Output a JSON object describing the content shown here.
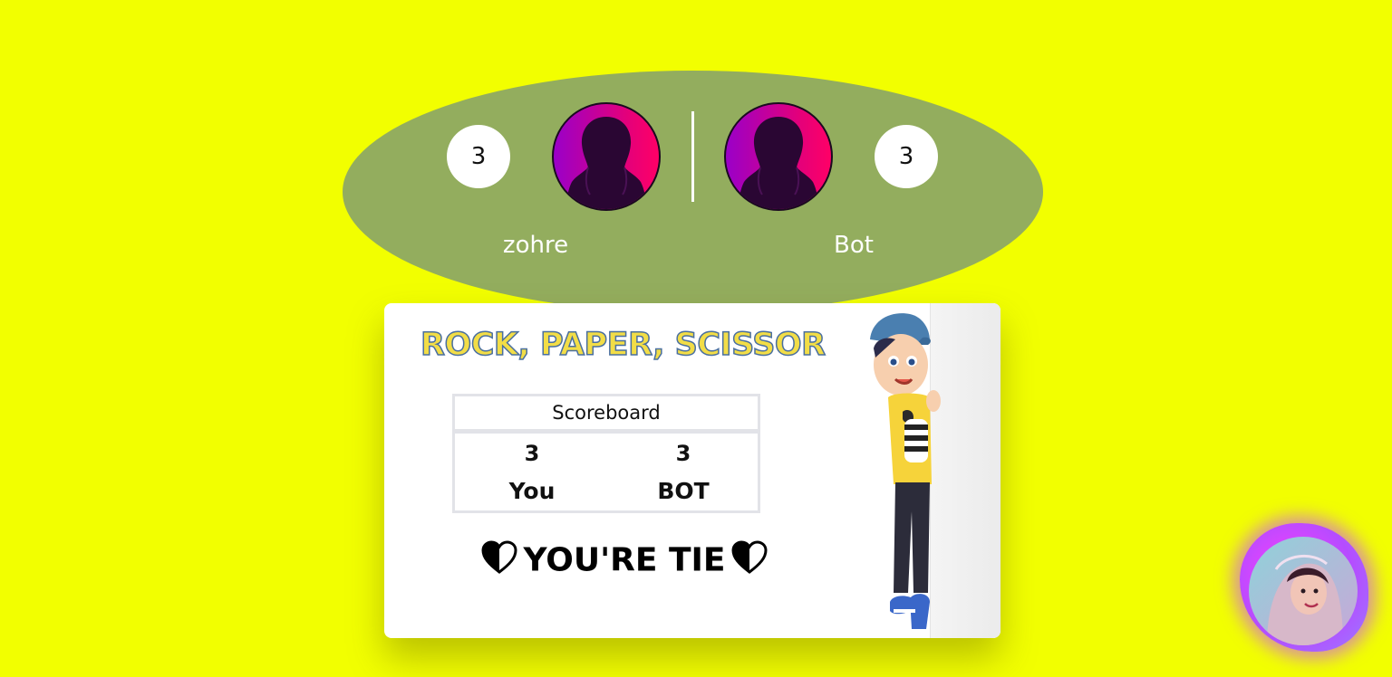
{
  "players": {
    "left": {
      "name": "zohre",
      "score": "3"
    },
    "right": {
      "name": "Bot",
      "score": "3"
    }
  },
  "game": {
    "title": "ROCK, PAPER, SCISSOR",
    "scoreboard": {
      "heading": "Scoreboard",
      "you_score": "3",
      "you_label": "You",
      "bot_score": "3",
      "bot_label": "BOT"
    },
    "result_text": "YOU'RE TIE"
  },
  "colors": {
    "background": "#f2ff00",
    "oval": "#93ad5e",
    "avatar_gradient_start": "#9a00c8",
    "avatar_gradient_end": "#e4007a",
    "title_fill": "#f2dd47",
    "title_stroke": "#4a6fa0"
  },
  "icons": {
    "player_avatar": "female-silhouette-icon",
    "result_heart": "half-heart-icon",
    "character": "cartoon-boy-peeking",
    "profile": "profile-photo"
  }
}
